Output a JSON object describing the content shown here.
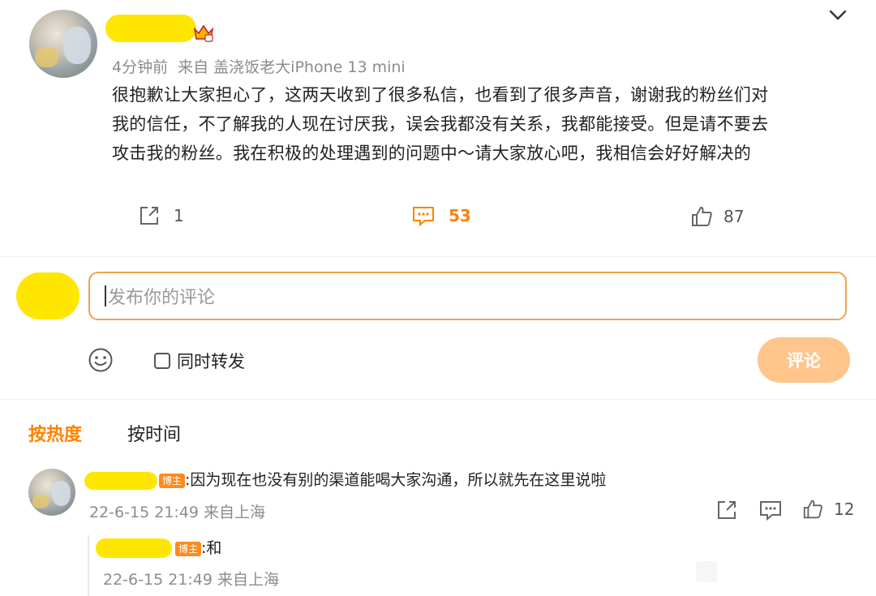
{
  "post": {
    "time": "4分钟前",
    "source": "来自 盖浇饭老大iPhone 13 mini",
    "body": [
      "很抱歉让大家担心了，这两天收到了很多私信，也看到了很多声音，谢谢我的粉丝们对",
      "我的信任，不了解我的人现在讨厌我，误会我都没有关系，我都能接受。但是请不要去",
      "攻击我的粉丝。我在积极的处理遇到的问题中～请大家放心吧，我相信会好好解决的"
    ],
    "share_count": "1",
    "comment_count": "53",
    "like_count": "87"
  },
  "composer": {
    "placeholder": "发布你的评论",
    "repost_label": "同时转发",
    "submit_label": "评论"
  },
  "sort": {
    "hot": "按热度",
    "time": "按时间"
  },
  "comments": [
    {
      "badge": "博主",
      "text": ":因为现在也没有别的渠道能喝大家沟通，所以就先在这里说啦",
      "meta": "22-6-15 21:49 来自上海",
      "like_count": "12"
    }
  ],
  "reply": {
    "badge": "博主",
    "text": ":和",
    "meta": "22-6-15 21:49 来自上海"
  },
  "colors": {
    "accent": "#ff8200",
    "submit_bg": "#ffc58a",
    "highlight": "#ffe600"
  }
}
